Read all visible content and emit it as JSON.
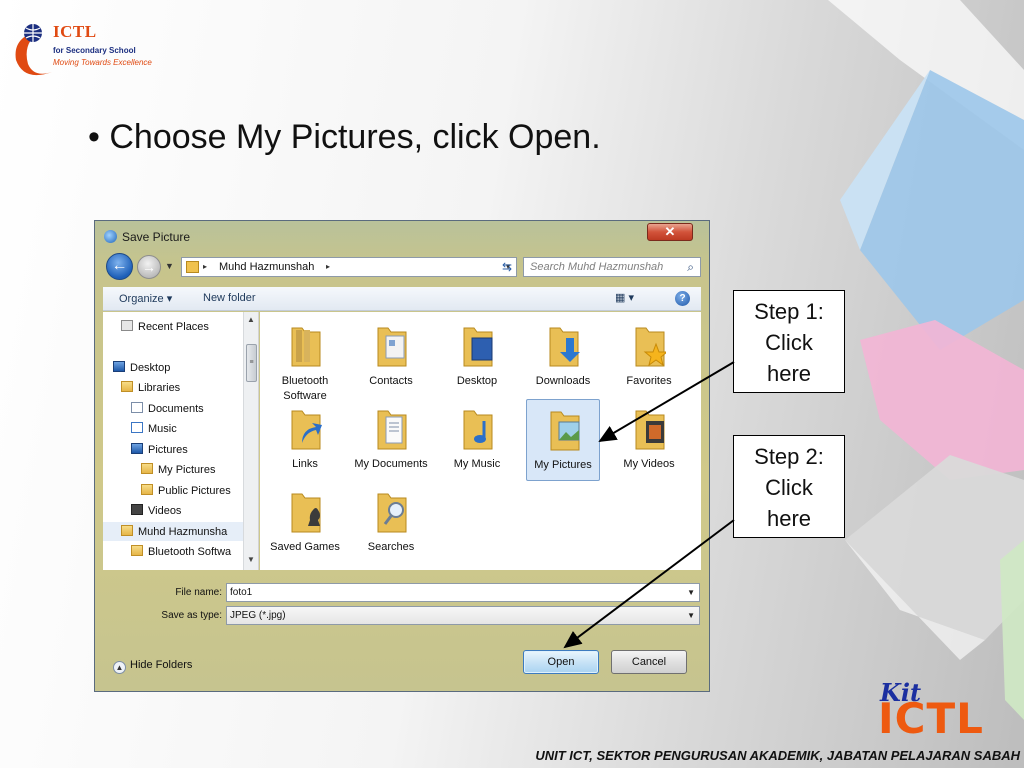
{
  "logo": {
    "name": "ICTL",
    "line1": "for Secondary School",
    "line2": "Moving Towards Excellence"
  },
  "bullet": "• Choose My Pictures, click Open.",
  "dialog": {
    "title": "Save Picture",
    "close_label": "✕",
    "address": {
      "location": "Muhd Hazmunshah",
      "arrow": "▸"
    },
    "search_placeholder": "Search Muhd Hazmunshah",
    "toolbar": {
      "organize": "Organize ▾",
      "new_folder": "New folder",
      "help": "?"
    },
    "nav_items": [
      {
        "label": "Recent Places",
        "icon": "recent-places-icon"
      },
      {
        "label": "Desktop",
        "icon": "desktop-icon"
      },
      {
        "label": "Libraries",
        "icon": "libraries-icon"
      },
      {
        "label": "Documents",
        "icon": "documents-icon"
      },
      {
        "label": "Music",
        "icon": "music-icon"
      },
      {
        "label": "Pictures",
        "icon": "pictures-icon"
      },
      {
        "label": "My Pictures",
        "icon": "folder-icon"
      },
      {
        "label": "Public Pictures",
        "icon": "folder-icon"
      },
      {
        "label": "Videos",
        "icon": "videos-icon"
      },
      {
        "label": "Muhd Hazmunsha",
        "icon": "user-folder-icon"
      },
      {
        "label": "Bluetooth Softwa",
        "icon": "folder-icon"
      }
    ],
    "files": [
      {
        "label": "Bluetooth Software",
        "icon": "bluetooth-folder-icon"
      },
      {
        "label": "Contacts",
        "icon": "contacts-folder-icon"
      },
      {
        "label": "Desktop",
        "icon": "desktop-folder-icon"
      },
      {
        "label": "Downloads",
        "icon": "downloads-folder-icon"
      },
      {
        "label": "Favorites",
        "icon": "favorites-folder-icon"
      },
      {
        "label": "Links",
        "icon": "links-folder-icon"
      },
      {
        "label": "My Documents",
        "icon": "documents-folder-icon"
      },
      {
        "label": "My Music",
        "icon": "music-folder-icon"
      },
      {
        "label": "My Pictures",
        "icon": "pictures-folder-icon",
        "selected": true
      },
      {
        "label": "My Videos",
        "icon": "videos-folder-icon"
      },
      {
        "label": "Saved Games",
        "icon": "saved-games-folder-icon"
      },
      {
        "label": "Searches",
        "icon": "searches-folder-icon"
      }
    ],
    "file_name_label": "File name:",
    "file_name_value": "foto1",
    "save_type_label": "Save as type:",
    "save_type_value": "JPEG (*.jpg)",
    "hide_folders": "Hide Folders",
    "open_button": "Open",
    "cancel_button": "Cancel"
  },
  "callouts": {
    "step1": [
      "Step 1:",
      "Click",
      "here"
    ],
    "step2": [
      "Step 2:",
      "Click",
      "here"
    ]
  },
  "footer": "UNIT ICT, SEKTOR PENGURUSAN AKADEMIK, JABATAN PELAJARAN SABAH",
  "kit_logo": {
    "kit": "Kit",
    "ictl": "ICTL"
  },
  "colors": {
    "accent_orange": "#e04a12",
    "selection_blue": "#d8e7f8",
    "close_red": "#c9432a"
  }
}
